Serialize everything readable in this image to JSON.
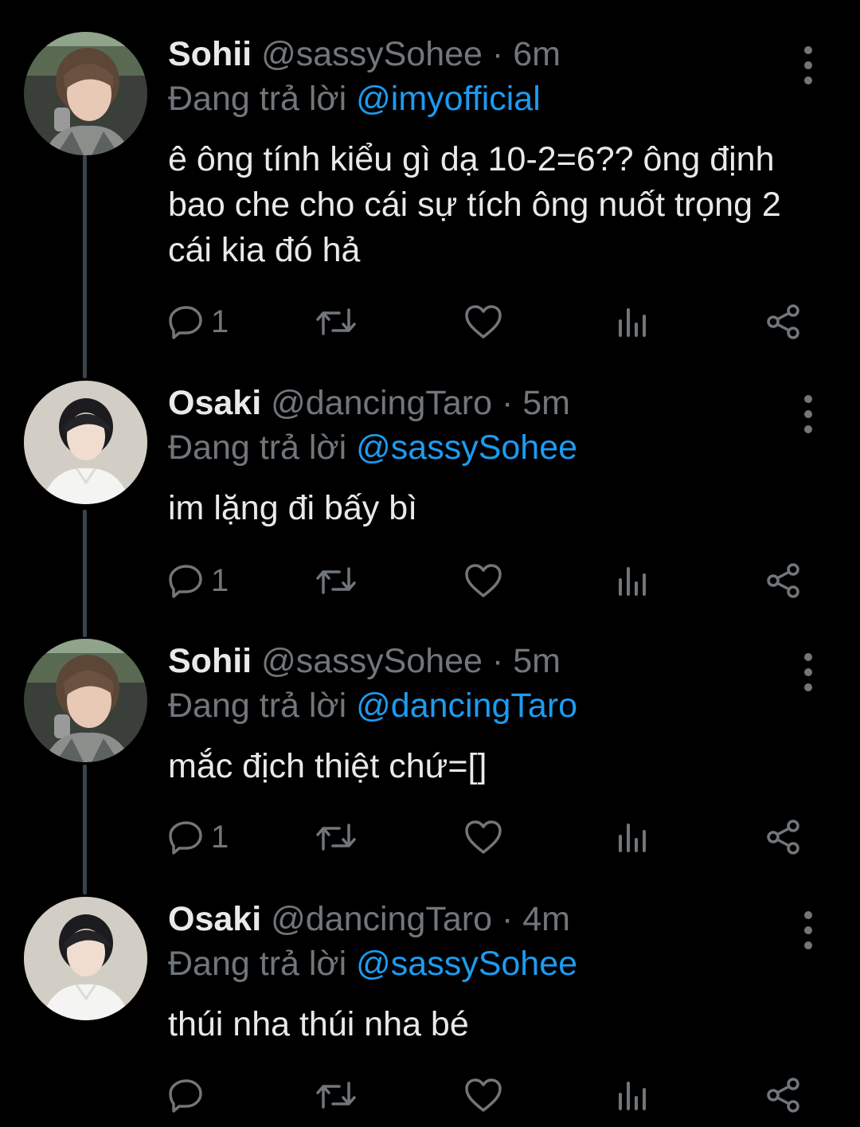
{
  "tweets": [
    {
      "name": "Sohii",
      "handle": "@sassySohee",
      "sep": "·",
      "time": "6m",
      "reply_prefix": "Đang trả lời",
      "reply_to": "@imyofficial",
      "text": "ê ông tính kiểu gì dạ 10-2=6?? ông định bao che cho cái sự tích ông nuốt trọng 2 cái kia đó hả",
      "reply_count": "1"
    },
    {
      "name": "Osaki",
      "handle": "@dancingTaro",
      "sep": "·",
      "time": "5m",
      "reply_prefix": "Đang trả lời",
      "reply_to": "@sassySohee",
      "text": "im lặng đi bấy bì",
      "reply_count": "1"
    },
    {
      "name": "Sohii",
      "handle": "@sassySohee",
      "sep": "·",
      "time": "5m",
      "reply_prefix": "Đang trả lời",
      "reply_to": "@dancingTaro",
      "text": "mắc địch thiệt chứ=[]",
      "reply_count": "1"
    },
    {
      "name": "Osaki",
      "handle": "@dancingTaro",
      "sep": "·",
      "time": "4m",
      "reply_prefix": "Đang trả lời",
      "reply_to": "@sassySohee",
      "text": "thúi nha thúi nha bé",
      "reply_count": ""
    }
  ],
  "icons": {
    "reply": "reply-icon",
    "retweet": "retweet-icon",
    "like": "heart-icon",
    "views": "views-icon",
    "share": "share-icon",
    "more": "more-options-icon"
  },
  "colors": {
    "background": "#000000",
    "text": "#e7e9ea",
    "secondary": "#71767b",
    "mention": "#1d9bf0",
    "thread_line": "#38444d"
  }
}
